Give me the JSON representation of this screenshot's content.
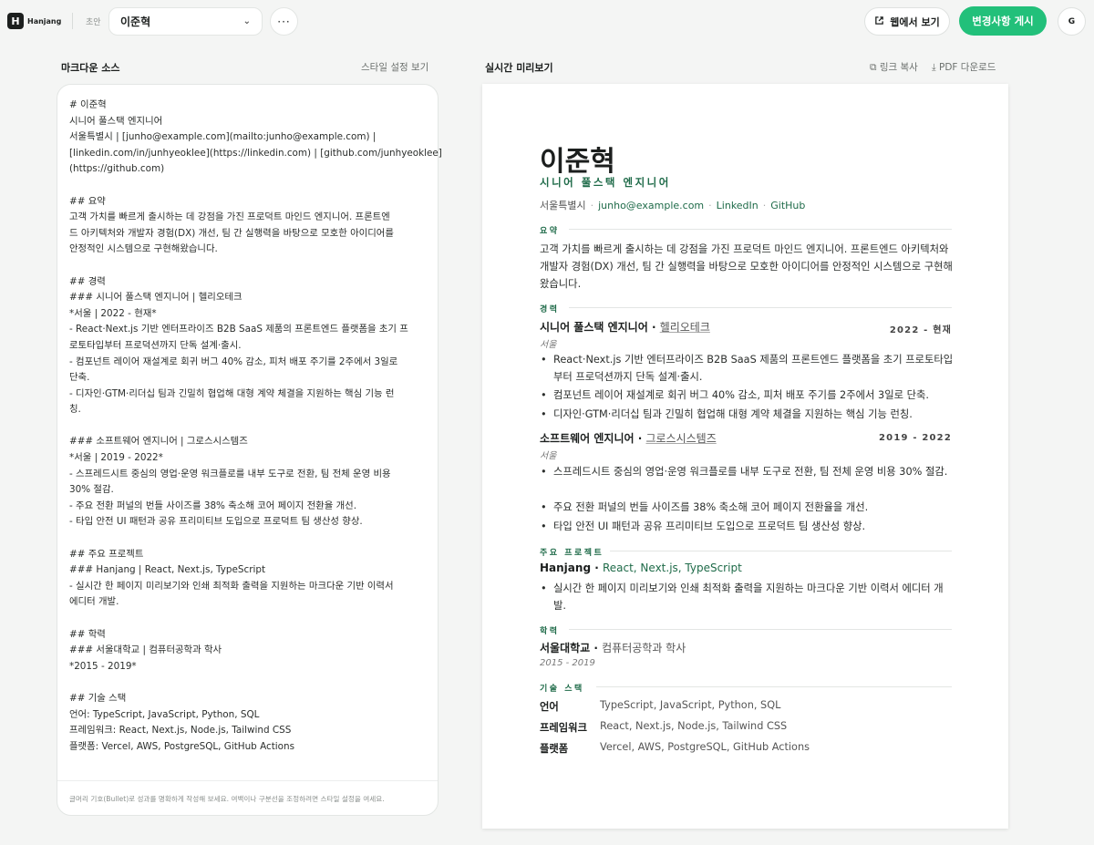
{
  "header": {
    "logo_mark": "H",
    "logo_text": "Hanjang",
    "draft_label": "초안",
    "document": "이준혁",
    "more_label": "···",
    "web_view": "웹에서 보기",
    "publish": "변경사항 게시",
    "avatar": "G"
  },
  "source": {
    "title": "마크다운 소스",
    "style_link": "스타일 설정 보기",
    "lines": [
      "# 이준혁",
      "시니어 풀스택 엔지니어",
      "서울특별시 | [junho@example.com](mailto:junho@example.com) |",
      "[linkedin.com/in/junhyeoklee](https://linkedin.com) | [github.com/junhyeoklee]",
      "(https://github.com)",
      "",
      "## 요약",
      "고객 가치를 빠르게 출시하는 데 강점을 가진 프로덕트 마인드 엔지니어. 프론트엔",
      "드 아키텍처와 개발자 경험(DX) 개선, 팀 간 실행력을 바탕으로 모호한 아이디어를",
      "안정적인 시스템으로 구현해왔습니다.",
      "",
      "## 경력",
      "### 시니어 풀스택 엔지니어 | 헬리오테크",
      "*서울 | 2022 - 현재*",
      "- React·Next.js 기반 엔터프라이즈 B2B SaaS 제품의 프론트엔드 플랫폼을 초기 프",
      "로토타입부터 프로덕션까지 단독 설계·출시.",
      "- 컴포넌트 레이어 재설계로 회귀 버그 40% 감소, 피처 배포 주기를 2주에서 3일로",
      "단축.",
      "- 디자인·GTM·리더십 팀과 긴밀히 협업해 대형 계약 체결을 지원하는 핵심 기능 런",
      "칭.",
      "",
      "### 소프트웨어 엔지니어 | 그로스시스템즈",
      "*서울 | 2019 - 2022*",
      "- 스프레드시트 중심의 영업·운영 워크플로를 내부 도구로 전환, 팀 전체 운영 비용",
      "30% 절감.",
      "- 주요 전환 퍼널의 번들 사이즈를 38% 축소해 코어 페이지 전환율 개선.",
      "- 타입 안전 UI 패턴과 공유 프리미티브 도입으로 프로덕트 팀 생산성 향상.",
      "",
      "## 주요 프로젝트",
      "### Hanjang | React, Next.js, TypeScript",
      "- 실시간 한 페이지 미리보기와 인쇄 최적화 출력을 지원하는 마크다운 기반 이력서",
      "에디터 개발.",
      "",
      "## 학력",
      "### 서울대학교 | 컴퓨터공학과 학사",
      "*2015 - 2019*",
      "",
      "## 기술 스택",
      "언어: TypeScript, JavaScript, Python, SQL",
      "프레임워크: React, Next.js, Node.js, Tailwind CSS",
      "플랫폼: Vercel, AWS, PostgreSQL, GitHub Actions"
    ],
    "hint": "글머리 기호(Bullet)로 성과를 명확하게 작성해 보세요. 여백이나 구분선을 조정하려면 스타일 설정을 여세요."
  },
  "preview": {
    "title": "실시간 미리보기",
    "copy_link": "링크 복사",
    "pdf_download": "PDF 다운로드",
    "name": "이준혁",
    "role": "시니어 풀스택 엔지니어",
    "contact": {
      "city": "서울특별시",
      "email": "junho@example.com",
      "linkedin": "LinkedIn",
      "github": "GitHub"
    },
    "summary_h": "요약",
    "summary": "고객 가치를 빠르게 출시하는 데 강점을 가진 프로덕트 마인드 엔지니어. 프론트엔드 아키텍처와 개발자 경험(DX) 개선, 팀 간 실행력을 바탕으로 모호한 아이디어를 안정적인 시스템으로 구현해왔습니다.",
    "career_h": "경력",
    "jobs": [
      {
        "title": "시니어 풀스택 엔지니어",
        "company": "헬리오테크",
        "date": "2022 - 현재",
        "location": "서울",
        "bullets": [
          "React·Next.js 기반 엔터프라이즈 B2B SaaS 제품의 프론트엔드 플랫폼을 초기 프로토타입부터 프로덕션까지 단독 설계·출시.",
          "컴포넌트 레이어 재설계로 회귀 버그 40% 감소, 피처 배포 주기를 2주에서 3일로 단축.",
          "디자인·GTM·리더십 팀과 긴밀히 협업해 대형 계약 체결을 지원하는 핵심 기능 런칭."
        ]
      },
      {
        "title": "소프트웨어 엔지니어",
        "company": "그로스시스템즈",
        "date": "2019 - 2022",
        "location": "서울",
        "bullets": [
          "스프레드시트 중심의 영업·운영 워크플로를 내부 도구로 전환, 팀 전체 운영 비용 30% 절감.",
          "주요 전환 퍼널의 번들 사이즈를 38% 축소해 코어 페이지 전환율을 개선.",
          "타입 안전 UI 패턴과 공유 프리미티브 도입으로 프로덕트 팀 생산성 향상."
        ]
      }
    ],
    "projects_h": "주요 프로젝트",
    "project": {
      "name": "Hanjang",
      "stack": "React, Next.js, TypeScript",
      "bullet": "실시간 한 페이지 미리보기와 인쇄 최적화 출력을 지원하는 마크다운 기반 이력서 에디터 개발."
    },
    "education_h": "학력",
    "education": {
      "school": "서울대학교",
      "degree": "컴퓨터공학과 학사",
      "years": "2015 - 2019"
    },
    "skills_h": "기술 스택",
    "skills": [
      {
        "key": "언어",
        "value": "TypeScript, JavaScript, Python, SQL"
      },
      {
        "key": "프레임워크",
        "value": "React, Next.js, Node.js, Tailwind CSS"
      },
      {
        "key": "플랫폼",
        "value": "Vercel, AWS, PostgreSQL, GitHub Actions"
      }
    ]
  },
  "colors": {
    "accent": "#22c07a",
    "heading_green": "#1f6b49",
    "background": "#f4f5f4"
  }
}
